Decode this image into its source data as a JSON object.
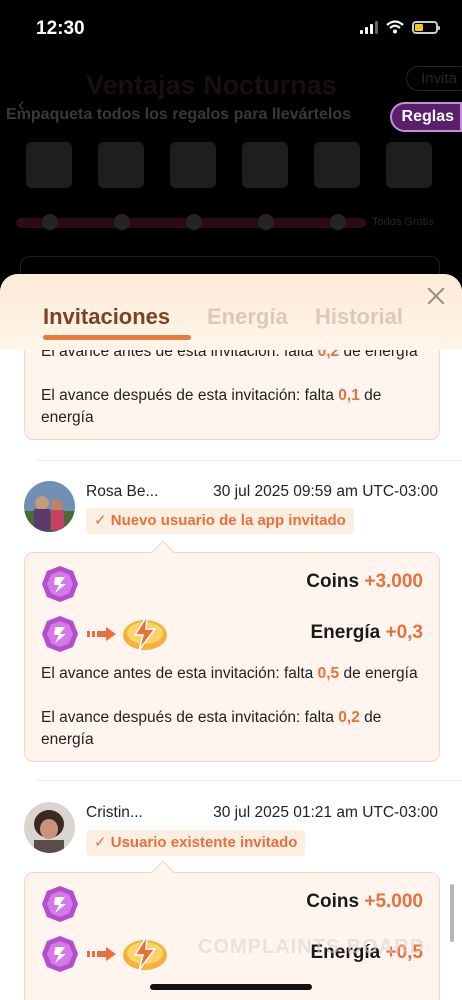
{
  "status_bar": {
    "time": "12:30"
  },
  "background": {
    "title": "Ventajas Nocturnas",
    "subtitle": "Empaqueta todos los regalos para llevártelos",
    "invite_label": "Invita",
    "rules_label": "Reglas",
    "all_done_label": "Todos Gratis"
  },
  "tabs": [
    {
      "label": "Invitaciones",
      "active": true
    },
    {
      "label": "Energía",
      "active": false
    },
    {
      "label": "Historial",
      "active": false
    }
  ],
  "partial_record": {
    "before_prefix": "El avance antes de esta invitación: falta ",
    "before_value": "0,2",
    "before_suffix": " de energía",
    "after_prefix": "El avance después de esta invitación: falta ",
    "after_value": "0,1",
    "after_suffix": " de energía"
  },
  "records": [
    {
      "name": "Rosa Be...",
      "datetime": "30 jul 2025 09:59 am UTC-03:00",
      "badge": "Nuevo usuario de la app invitado",
      "coins_label": "Coins",
      "coins_value": "+3.000",
      "energy_label": "Energía",
      "energy_value": "+0,3",
      "before_prefix": "El avance antes de esta invitación: falta ",
      "before_value": "0,5",
      "before_suffix": " de energía",
      "after_prefix": "El avance después de esta invitación: falta ",
      "after_value": "0,2",
      "after_suffix": " de energía"
    },
    {
      "name": "Cristin...",
      "datetime": "30 jul 2025 01:21 am UTC-03:00",
      "badge": "Usuario existente invitado",
      "coins_label": "Coins",
      "coins_value": "+5.000",
      "energy_label": "Energía",
      "energy_value": "+0,5"
    }
  ],
  "watermark": "COMPLAINTS BOARD",
  "colors": {
    "accent": "#e8703c",
    "tab_active": "#7a4326",
    "tab_inactive": "#dcc8bd",
    "card_bg": "#fff5ee",
    "gem": "#b34fcc"
  }
}
